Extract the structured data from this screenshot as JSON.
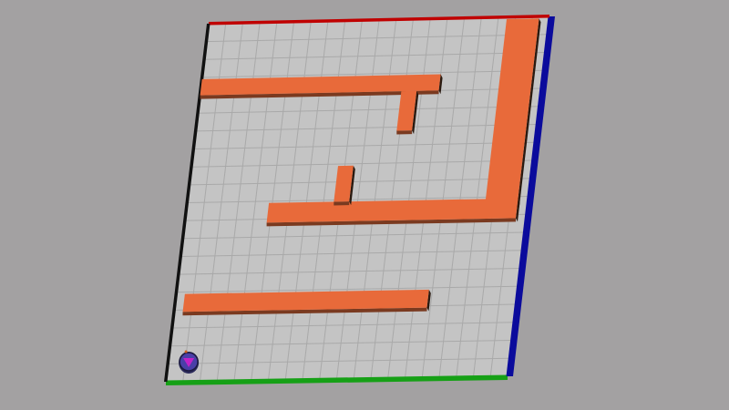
{
  "scene": {
    "background_color": "#a3a1a2",
    "board_color": "#c4c4c4",
    "grid_line_color": "#a9a9a9",
    "grid_cells": 20,
    "wall_color": "#e86a3a",
    "wall_side_color": "#7a3a20",
    "wall_dark_edge": "#2a1a10"
  },
  "borders": {
    "top": {
      "color": "#c00000"
    },
    "right": {
      "color": "#0b0b9c"
    },
    "bottom": {
      "color": "#16a016"
    },
    "left": {
      "color": "#111111"
    }
  },
  "walls": [
    {
      "name": "wall-upper-horizontal",
      "cells": [
        0,
        3.1,
        14.0,
        4.0
      ]
    },
    {
      "name": "wall-upper-stub",
      "cells": [
        11.8,
        4.0,
        12.7,
        6.2
      ]
    },
    {
      "name": "wall-right-vertical",
      "cells": [
        17.5,
        0.1,
        19.4,
        10.4
      ]
    },
    {
      "name": "wall-middle-horizontal",
      "cells": [
        4.8,
        10.1,
        19.4,
        11.2
      ]
    },
    {
      "name": "wall-middle-stub",
      "cells": [
        8.6,
        8.1,
        9.5,
        10.1
      ]
    },
    {
      "name": "wall-lower-horizontal",
      "cells": [
        0.5,
        15.1,
        14.8,
        16.1
      ]
    }
  ],
  "robot": {
    "name": "robot",
    "body_color": "#4a3fa8",
    "marker_color": "#c022c8",
    "cell": [
      1.2,
      18.9
    ]
  }
}
